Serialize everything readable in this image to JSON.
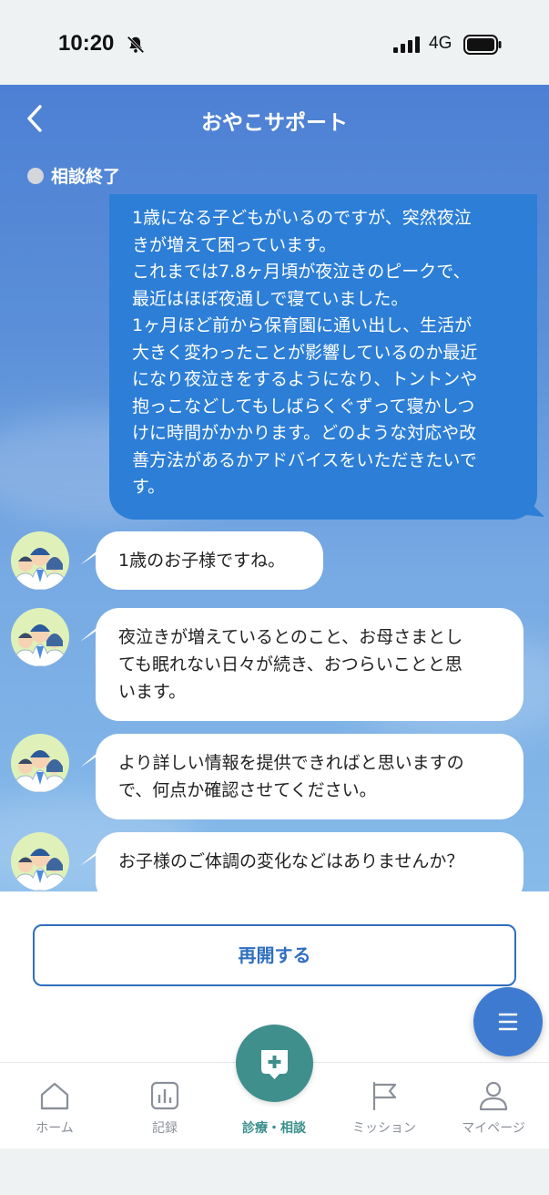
{
  "status_bar": {
    "time": "10:20",
    "network": "4G"
  },
  "header": {
    "title": "おやこサポート"
  },
  "consultation_status": "相談終了",
  "messages": {
    "user": [
      "1歳になる子どもがいるのですが、突然夜泣",
      "きが増えて困っています。",
      "これまでは7.8ヶ月頃が夜泣きのピークで、",
      "最近はほぼ夜通しで寝ていました。",
      "1ヶ月ほど前から保育園に通い出し、生活が",
      "大きく変わったことが影響しているのか最近",
      "になり夜泣きをするようになり、トントンや",
      "抱っこなどしてもしばらくぐずって寝かしつ",
      "けに時間がかかります。どのような対応や改",
      "善方法があるかアドバイスをいただきたいで",
      "す。"
    ],
    "bot": [
      [
        "1歳のお子様ですね。"
      ],
      [
        "夜泣きが増えているとのこと、お母さまとし",
        "ても眠れない日々が続き、おつらいことと思",
        "います。"
      ],
      [
        "より詳しい情報を提供できればと思いますの",
        "で、何点か確認させてください。"
      ],
      [
        "お子様のご体調の変化などはありませんか？"
      ]
    ]
  },
  "reopen_button": "再開する",
  "tabs": [
    {
      "label": "ホーム",
      "icon": "home-icon"
    },
    {
      "label": "記録",
      "icon": "chart-icon"
    },
    {
      "label": "診療・相談",
      "icon": "medical-chat-icon",
      "active": true
    },
    {
      "label": "ミッション",
      "icon": "flag-icon"
    },
    {
      "label": "マイページ",
      "icon": "person-icon"
    }
  ],
  "colors": {
    "user_bubble": "#2c7ed6",
    "accent": "#2f6fbe",
    "active_tab": "#3a8f8c"
  }
}
